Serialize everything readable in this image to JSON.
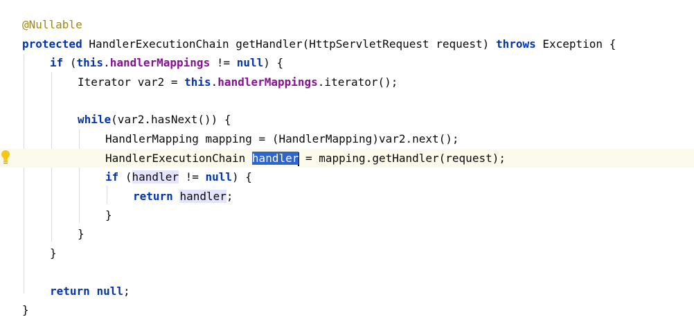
{
  "editor": {
    "lines": [
      [
        {
          "t": "@Nullable",
          "c": "anno"
        }
      ],
      [
        {
          "t": "protected",
          "c": "kw"
        },
        {
          "t": " HandlerExecutionChain getHandler(HttpServletRequest request) "
        },
        {
          "t": "throws",
          "c": "kw"
        },
        {
          "t": " Exception {"
        }
      ],
      [
        {
          "t": "if",
          "c": "kw"
        },
        {
          "t": " ("
        },
        {
          "t": "this",
          "c": "kw"
        },
        {
          "t": "."
        },
        {
          "t": "handlerMappings",
          "c": "field"
        },
        {
          "t": " != "
        },
        {
          "t": "null",
          "c": "kw"
        },
        {
          "t": ") {"
        }
      ],
      [
        {
          "t": "Iterator var2 = "
        },
        {
          "t": "this",
          "c": "kw"
        },
        {
          "t": "."
        },
        {
          "t": "handlerMappings",
          "c": "field"
        },
        {
          "t": ".iterator();"
        }
      ],
      [],
      [
        {
          "t": "while",
          "c": "kw"
        },
        {
          "t": "(var2.hasNext()) {"
        }
      ],
      [
        {
          "t": "HandlerMapping mapping = (HandlerMapping)var2.next();"
        }
      ],
      [
        {
          "t": "HandlerExecutionChain "
        },
        {
          "t": "handler",
          "c": "sel"
        },
        {
          "t": "",
          "c": "caret"
        },
        {
          "t": " = mapping.getHandler(request);"
        }
      ],
      [
        {
          "t": "if",
          "c": "kw"
        },
        {
          "t": " ("
        },
        {
          "t": "handler",
          "c": "usage"
        },
        {
          "t": " != "
        },
        {
          "t": "null",
          "c": "kw"
        },
        {
          "t": ") {"
        }
      ],
      [
        {
          "t": "return",
          "c": "kw"
        },
        {
          "t": " "
        },
        {
          "t": "handler",
          "c": "usage"
        },
        {
          "t": ";"
        }
      ],
      [
        {
          "t": "}"
        }
      ],
      [
        {
          "t": "}"
        }
      ],
      [
        {
          "t": "}"
        }
      ],
      [],
      [
        {
          "t": "return",
          "c": "kw"
        },
        {
          "t": " "
        },
        {
          "t": "null",
          "c": "kw"
        },
        {
          "t": ";"
        }
      ],
      [
        {
          "t": "}"
        }
      ]
    ]
  }
}
